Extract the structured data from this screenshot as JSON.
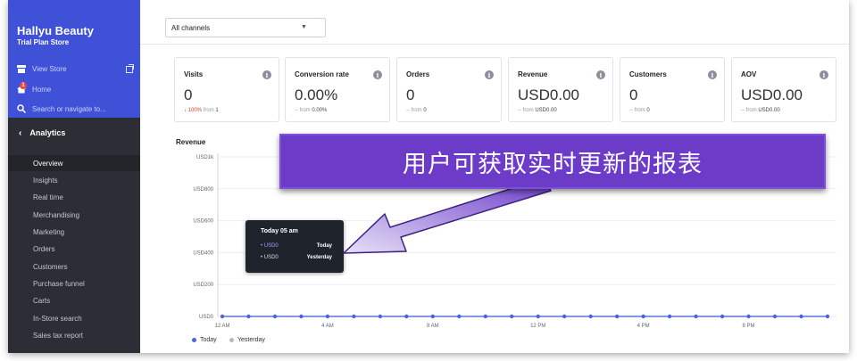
{
  "sidebar": {
    "store_name": "Hallyu Beauty",
    "store_plan": "Trial Plan Store",
    "view_store": "View Store",
    "home": "Home",
    "home_badge": "1",
    "search": "Search or navigate to...",
    "section": "Analytics",
    "items": [
      {
        "label": "Overview"
      },
      {
        "label": "Insights"
      },
      {
        "label": "Real time"
      },
      {
        "label": "Merchandising"
      },
      {
        "label": "Marketing"
      },
      {
        "label": "Orders"
      },
      {
        "label": "Customers"
      },
      {
        "label": "Purchase funnel"
      },
      {
        "label": "Carts"
      },
      {
        "label": "In-Store search"
      },
      {
        "label": "Sales tax report"
      }
    ],
    "colors": {
      "top": "#3f51d6",
      "bottom": "#2b2e35"
    }
  },
  "filters": {
    "channel": "All channels"
  },
  "cards": [
    {
      "title": "Visits",
      "value": "0",
      "change": "100%",
      "from_text": "from",
      "from_value": "1"
    },
    {
      "title": "Conversion rate",
      "value": "0.00%",
      "change": "--",
      "from_text": "from",
      "from_value": "0.00%"
    },
    {
      "title": "Orders",
      "value": "0",
      "change": "--",
      "from_text": "from",
      "from_value": "0"
    },
    {
      "title": "Revenue",
      "value": "USD0.00",
      "change": "--",
      "from_text": "from",
      "from_value": "USD0.00"
    },
    {
      "title": "Customers",
      "value": "0",
      "change": "--",
      "from_text": "from",
      "from_value": "0"
    },
    {
      "title": "AOV",
      "value": "USD0.00",
      "change": "--",
      "from_text": "from",
      "from_value": "USD0.00"
    }
  ],
  "revenue_chart_title": "Revenue",
  "chart_data": {
    "type": "line",
    "y_ticks": [
      "USD1k",
      "USD800",
      "USD600",
      "USD400",
      "USD200",
      "USD0"
    ],
    "x_ticks": [
      "12 AM",
      "4 AM",
      "8 AM",
      "12 PM",
      "4 PM",
      "8 PM"
    ],
    "ylim": [
      0,
      1000
    ],
    "series": [
      {
        "name": "Today",
        "color": "#4a63e0",
        "values": [
          0,
          0,
          0,
          0,
          0,
          0,
          0,
          0,
          0,
          0,
          0,
          0,
          0,
          0,
          0,
          0,
          0,
          0,
          0,
          0,
          0,
          0,
          0,
          0
        ]
      },
      {
        "name": "Yesterday",
        "color": "#b4b8c2",
        "values": [
          0,
          0,
          0,
          0,
          0,
          0,
          0,
          0,
          0,
          0,
          0,
          0,
          0,
          0,
          0,
          0,
          0,
          0,
          0,
          0,
          0,
          0,
          0,
          0
        ]
      }
    ]
  },
  "tooltip": {
    "title": "Today 05 am",
    "rows": [
      {
        "value": "• USD0",
        "label": "Today"
      },
      {
        "value": "• USD0",
        "label": "Yesterday"
      }
    ]
  },
  "annotation": {
    "text": "用户可获取实时更新的报表",
    "color": "#6c3cc9"
  }
}
